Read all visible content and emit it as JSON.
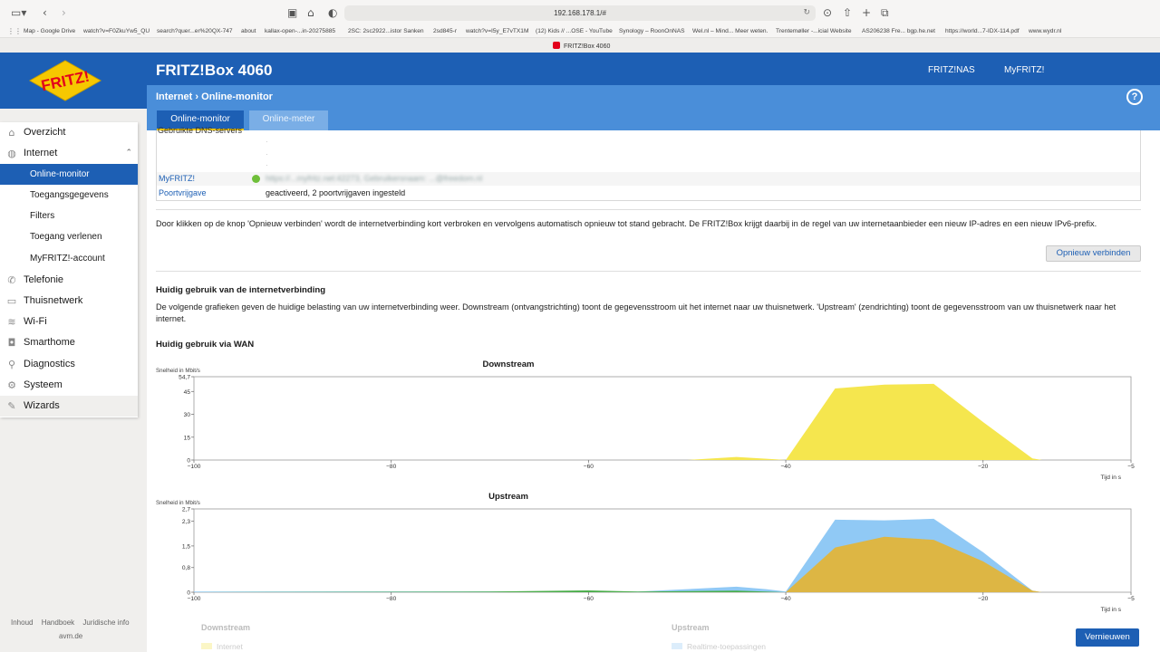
{
  "browser": {
    "url": "192.168.178.1/#",
    "tab_title": "FRITZ!Box 4060",
    "bookmarks": [
      "Map - Google Drive",
      "watch?v=F0ZkuYw5_QU",
      "search?quer...er%20QX-747",
      "about",
      "kallax-open-...in-20275885",
      "2SC: 2sc2922...istor Sanken",
      "2sd845-r",
      "watch?v=I5y_E7vTX1M",
      "(12) Kids // ...OSE - YouTube",
      "Synology – RoonOnNAS",
      "Wel.nl – Mind... Meer weten.",
      "Trentemøller -...icial Website",
      "AS206238 Fre... bgp.he.net",
      "https://world...7-IDX-114.pdf",
      "www.wydr.nl"
    ]
  },
  "header": {
    "logo_text": "FRITZ!",
    "product": "FRITZ!Box 4060",
    "links": [
      "FRITZ!NAS",
      "MyFRITZ!"
    ],
    "breadcrumb_parent": "Internet",
    "breadcrumb_sep": "›",
    "breadcrumb_current": "Online-monitor",
    "help_label": "?",
    "tabs": [
      "Online-monitor",
      "Online-meter"
    ]
  },
  "sidebar": {
    "items": [
      {
        "label": "Overzicht",
        "icon": "home-icon"
      },
      {
        "label": "Internet",
        "icon": "globe-icon"
      },
      {
        "label": "Telefonie",
        "icon": "phone-icon"
      },
      {
        "label": "Thuisnetwerk",
        "icon": "network-icon"
      },
      {
        "label": "Wi-Fi",
        "icon": "wifi-icon"
      },
      {
        "label": "Smarthome",
        "icon": "smarthome-icon"
      },
      {
        "label": "Diagnostics",
        "icon": "diagnostics-icon"
      },
      {
        "label": "Systeem",
        "icon": "system-icon"
      },
      {
        "label": "Wizards",
        "icon": "wizard-icon"
      }
    ],
    "subitems": [
      "Online-monitor",
      "Toegangsgegevens",
      "Filters",
      "Toegang verlenen",
      "MyFRITZ!-account"
    ],
    "footer_links": [
      "Inhoud",
      "Handboek",
      "Juridische info"
    ],
    "footer_brand": "avm.de"
  },
  "content": {
    "dns_label": "Gebruikte DNS-servers",
    "myfritz_label": "MyFRITZ!",
    "myfritz_value": "https://...myfritz.net:42273, Gebruikersnaam: ...@freedom.nl",
    "port_label": "Poortvrijgave",
    "port_value": "geactiveerd, 2 poortvrijgaven ingesteld",
    "reconnect_text": "Door klikken op de knop 'Opnieuw verbinden' wordt de internetverbinding kort verbroken en vervolgens automatisch opnieuw tot stand gebracht. De FRITZ!Box krijgt daarbij in de regel van uw internetaanbieder een nieuw IP-adres en een nieuw IPv6-prefix.",
    "reconnect_button": "Opnieuw verbinden",
    "usage_heading": "Huidig gebruik van de internetverbinding",
    "usage_text": "De volgende grafieken geven de huidige belasting van uw internetverbinding weer. Downstream (ontvangstrichting) toont de gegevensstroom uit het internet naar uw thuisnetwerk. 'Upstream' (zendrichting) toont de gegevensstroom van uw thuisnetwerk naar het internet.",
    "wan_heading": "Huidig gebruik via WAN",
    "refresh_button": "Vernieuwen",
    "legend_downstream_title": "Downstream",
    "legend_downstream_item": "Internet",
    "legend_upstream_title": "Upstream",
    "legend_upstream_item": "Realtime-toepassingen"
  },
  "colors": {
    "brand_blue": "#1d5fb4",
    "subbar_blue": "#4a8ed9",
    "downstream_yellow": "#f5e64e",
    "upstream_blue": "#90c9f5",
    "upstream_orange": "#ddb644",
    "upstream_green": "#4cae4c"
  },
  "chart_data": [
    {
      "type": "area",
      "title": "Downstream",
      "ylabel": "Snelheid in Mbit/s",
      "xlabel": "Tijd in s",
      "xlim": [
        -100,
        -5
      ],
      "ylim": [
        0,
        54.7
      ],
      "x_ticks": [
        -100,
        -80,
        -60,
        -40,
        -20,
        -5
      ],
      "y_ticks": [
        0,
        15,
        30,
        45,
        54.7
      ],
      "y_tick_labels": [
        "0",
        "15",
        "30",
        "45",
        "54,7"
      ],
      "series": [
        {
          "name": "Internet",
          "color": "#f5e64e",
          "x": [
            -100,
            -50,
            -45,
            -41,
            -40,
            -35,
            -30,
            -25,
            -20,
            -15,
            -14,
            -5
          ],
          "y": [
            0,
            0,
            2,
            0.5,
            0,
            47,
            49.5,
            50,
            25,
            1,
            0,
            0
          ]
        }
      ]
    },
    {
      "type": "area",
      "title": "Upstream",
      "ylabel": "Snelheid in Mbit/s",
      "xlabel": "Tijd in s",
      "xlim": [
        -100,
        -5
      ],
      "ylim": [
        0,
        2.7
      ],
      "x_ticks": [
        -100,
        -80,
        -60,
        -40,
        -20,
        -5
      ],
      "y_ticks": [
        0,
        0.8,
        1.5,
        2.3,
        2.7
      ],
      "y_tick_labels": [
        "0",
        "0,8",
        "1,5",
        "2,3",
        "2,7"
      ],
      "series": [
        {
          "name": "Realtime-toepassingen",
          "color": "#90c9f5",
          "x": [
            -100,
            -60,
            -55,
            -45,
            -42,
            -40,
            -35,
            -30,
            -25,
            -20,
            -15,
            -14,
            -5
          ],
          "y": [
            0.02,
            0.03,
            0.02,
            0.18,
            0.1,
            0.02,
            2.35,
            2.33,
            2.38,
            1.3,
            0.05,
            0,
            0
          ]
        },
        {
          "name": "",
          "color": "#ddb644",
          "x": [
            -100,
            -40,
            -35,
            -30,
            -25,
            -20,
            -15,
            -14,
            -5
          ],
          "y": [
            0,
            0,
            1.45,
            1.8,
            1.7,
            1.0,
            0.05,
            0,
            0
          ]
        },
        {
          "name": "",
          "color": "#4cae4c",
          "x": [
            -100,
            -70,
            -60,
            -55,
            -45,
            -40,
            -5
          ],
          "y": [
            0,
            0.02,
            0.06,
            0.02,
            0.05,
            0,
            0
          ]
        }
      ]
    }
  ]
}
